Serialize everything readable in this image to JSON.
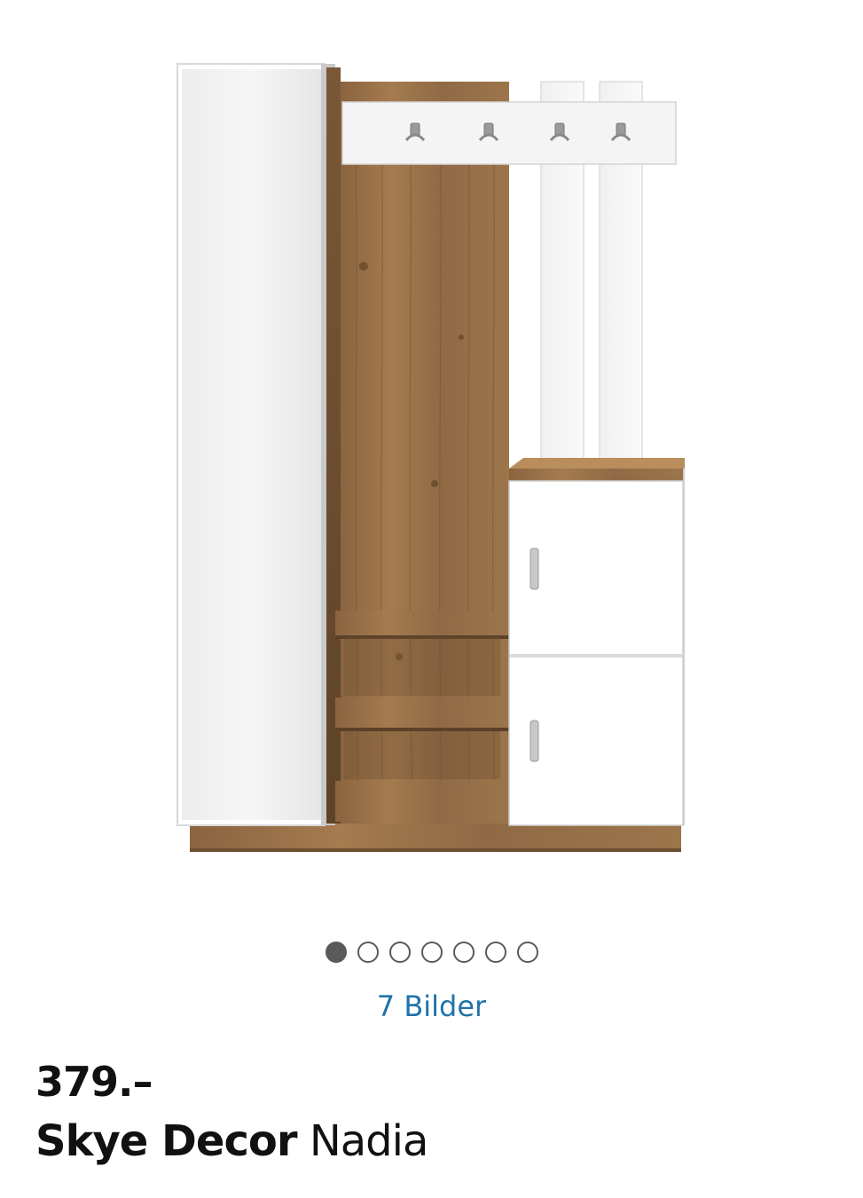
{
  "gallery": {
    "image_alt": "Skye Decor Nadia",
    "dot_count": 7,
    "active_index": 0,
    "image_count_label": "7 Bilder"
  },
  "product": {
    "price": "379.–",
    "brand": "Skye Decor",
    "model": "Nadia"
  }
}
